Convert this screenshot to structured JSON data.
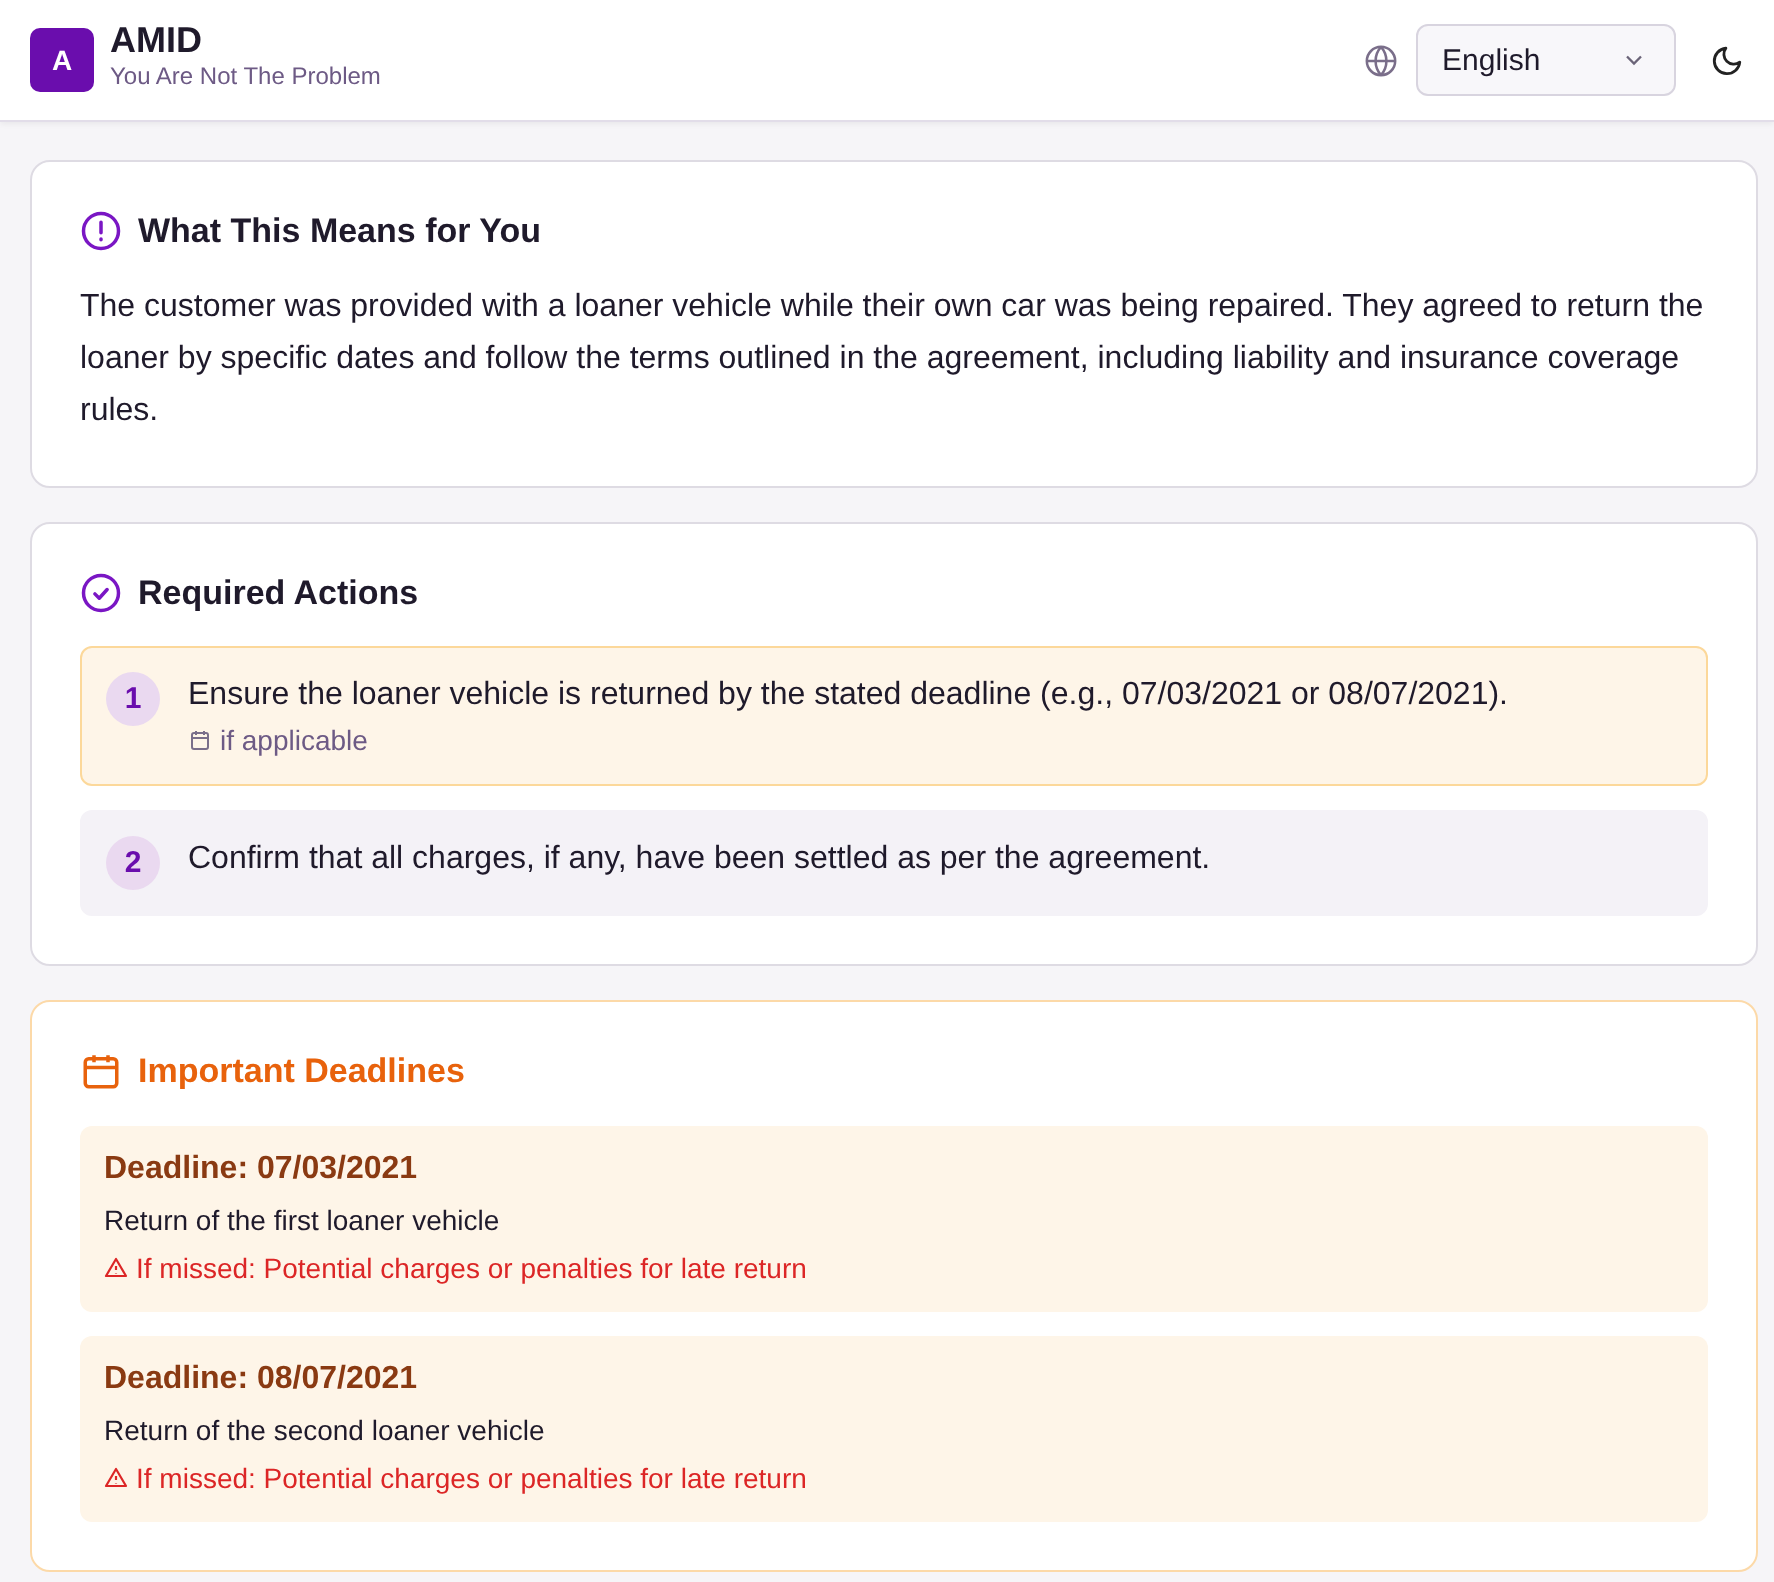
{
  "header": {
    "logo_letter": "A",
    "title": "AMID",
    "subtitle": "You Are Not The Problem",
    "language": "English"
  },
  "meaning": {
    "title": "What This Means for You",
    "text": "The customer was provided with a loaner vehicle while their own car was being repaired. They agreed to return the loaner by specific dates and follow the terms outlined in the agreement, including liability and insurance coverage rules."
  },
  "actions": {
    "title": "Required Actions",
    "items": [
      {
        "number": "1",
        "text": "Ensure the loaner vehicle is returned by the stated deadline (e.g., 07/03/2021 or 08/07/2021).",
        "note": "if applicable",
        "highlighted": true
      },
      {
        "number": "2",
        "text": "Confirm that all charges, if any, have been settled as per the agreement.",
        "highlighted": false
      }
    ]
  },
  "deadlines": {
    "title": "Important Deadlines",
    "items": [
      {
        "date": "Deadline: 07/03/2021",
        "description": "Return of the first loaner vehicle",
        "consequence": "If missed: Potential charges or penalties for late return"
      },
      {
        "date": "Deadline: 08/07/2021",
        "description": "Return of the second loaner vehicle",
        "consequence": "If missed: Potential charges or penalties for late return"
      }
    ]
  }
}
